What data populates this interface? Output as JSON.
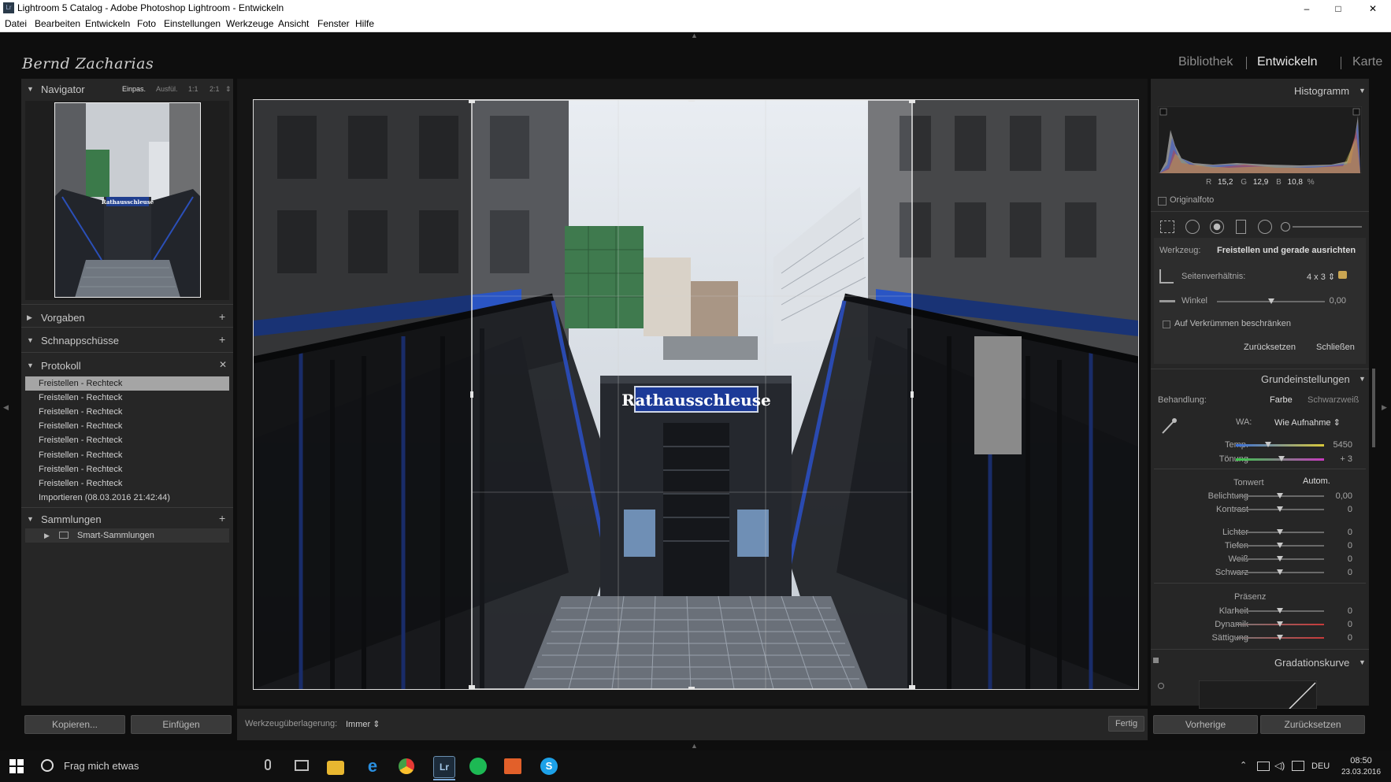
{
  "window": {
    "title": "Lightroom 5 Catalog - Adobe Photoshop Lightroom - Entwickeln",
    "app_icon": "Lr",
    "controls": [
      "–",
      "□",
      "✕"
    ]
  },
  "menu": [
    "Datei",
    "Bearbeiten",
    "Entwickeln",
    "Foto",
    "Einstellungen",
    "Werkzeuge",
    "Ansicht",
    "Fenster",
    "Hilfe"
  ],
  "identity_plate": "Bernd Zacharias",
  "modules": [
    "Bibliothek",
    "Entwickeln",
    "Karte"
  ],
  "left": {
    "navigator": {
      "title": "Navigator",
      "zoom": [
        "Einpas.",
        "Ausfül.",
        "1:1",
        "2:1"
      ],
      "zoom_more": "⇕",
      "thumb_sign": "Rathausschleuse"
    },
    "vorgaben": "Vorgaben",
    "schnappschuesse": "Schnappschüsse",
    "protokoll": {
      "title": "Protokoll",
      "items": [
        "Freistellen - Rechteck",
        "Freistellen - Rechteck",
        "Freistellen - Rechteck",
        "Freistellen - Rechteck",
        "Freistellen - Rechteck",
        "Freistellen - Rechteck",
        "Freistellen - Rechteck",
        "Freistellen - Rechteck",
        "Importieren (08.03.2016 21:42:44)"
      ]
    },
    "sammlungen": {
      "title": "Sammlungen",
      "items": [
        "Smart-Sammlungen"
      ]
    },
    "buttons": {
      "copy": "Kopieren...",
      "paste": "Einfügen"
    }
  },
  "photo": {
    "sign": "Rathausschleuse"
  },
  "toolbar": {
    "overlay_label": "Werkzeugüberlagerung:",
    "overlay_value": "Immer ⇕",
    "done": "Fertig"
  },
  "right": {
    "histogram": {
      "title": "Histogramm",
      "r_label": "R",
      "r": "15,2",
      "g_label": "G",
      "g": "12,9",
      "b_label": "B",
      "b": "10,8",
      "unit": "%",
      "original": "Originalfoto"
    },
    "crop": {
      "tool_label": "Werkzeug:",
      "tool_name": "Freistellen und gerade ausrichten",
      "aspect_label": "Seitenverhältnis:",
      "aspect_value": "4 x 3 ⇕",
      "angle_label": "Winkel",
      "angle_value": "0,00",
      "constrain": "Auf Verkrümmen beschränken",
      "reset": "Zurücksetzen",
      "close": "Schließen"
    },
    "basic": {
      "title": "Grundeinstellungen",
      "treatment_label": "Behandlung:",
      "treatment_color": "Farbe",
      "treatment_bw": "Schwarzweiß",
      "wb_label": "WA:",
      "wb_value": "Wie Aufnahme ⇕",
      "temp_label": "Temp.",
      "temp_value": "5450",
      "tint_label": "Tönung",
      "tint_value": "+ 3",
      "tone_label": "Tonwert",
      "auto": "Autom.",
      "exposure_label": "Belichtung",
      "exposure_value": "0,00",
      "contrast_label": "Kontrast",
      "contrast_value": "0",
      "highlights_label": "Lichter",
      "highlights_value": "0",
      "shadows_label": "Tiefen",
      "shadows_value": "0",
      "whites_label": "Weiß",
      "whites_value": "0",
      "blacks_label": "Schwarz",
      "blacks_value": "0",
      "presence_label": "Präsenz",
      "clarity_label": "Klarheit",
      "clarity_value": "0",
      "vibrance_label": "Dynamik",
      "vibrance_value": "0",
      "saturation_label": "Sättigung",
      "saturation_value": "0"
    },
    "curve": {
      "title": "Gradationskurve"
    },
    "buttons": {
      "previous": "Vorherige",
      "reset": "Zurücksetzen"
    }
  },
  "taskbar": {
    "search": "Frag mich etwas",
    "lang": "DEU",
    "time": "08:50",
    "date": "23.03.2016",
    "lr_icon": "Lr",
    "skype_icon": "S",
    "edge_icon": "e"
  }
}
